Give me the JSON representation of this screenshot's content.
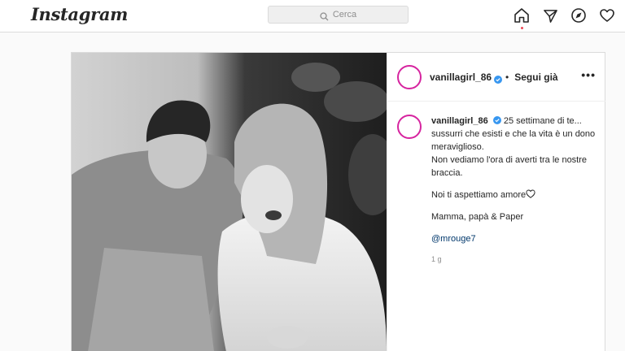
{
  "brand": {
    "logo_text": "Instagram"
  },
  "search": {
    "placeholder": "Cerca"
  },
  "nav": {
    "home_icon": "home-icon",
    "direct_icon": "paper-plane-icon",
    "explore_icon": "compass-icon",
    "activity_icon": "heart-icon",
    "notification_dot_color": "#ed4956"
  },
  "post": {
    "username": "vanillagirl_86",
    "follow_label": "Segui già",
    "more_label": "•••",
    "caption": {
      "username": "vanillagirl_86",
      "line1": "25 settimane di te...",
      "line2": "sussurri che esisti e che la vita è un dono meraviglioso.",
      "line3": "Non vediamo l'ora di averti tra le nostre braccia.",
      "line4": "Noi ti aspettiamo amore",
      "line4_icon": "heart-outline-icon",
      "line5": "Mamma, papà & Paper",
      "mention": "@mrouge7"
    },
    "time": "1 g",
    "verified_color": "#3897f0"
  }
}
